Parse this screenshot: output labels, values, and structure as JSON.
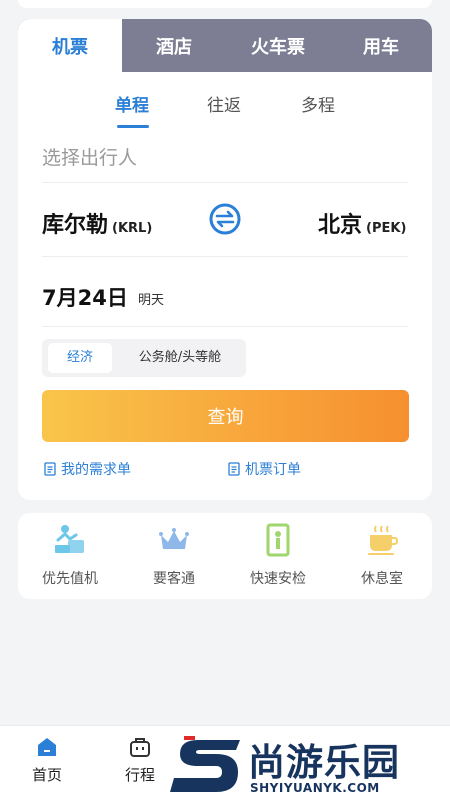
{
  "tabs": [
    {
      "label": "机票",
      "active": true
    },
    {
      "label": "酒店",
      "active": false
    },
    {
      "label": "火车票",
      "active": false
    },
    {
      "label": "用车",
      "active": false
    }
  ],
  "trip_types": [
    {
      "label": "单程",
      "active": true
    },
    {
      "label": "往返",
      "active": false
    },
    {
      "label": "多程",
      "active": false
    }
  ],
  "passenger_placeholder": "选择出行人",
  "route": {
    "from_city": "库尔勒",
    "from_code": "(KRL)",
    "to_city": "北京",
    "to_code": "(PEK)"
  },
  "date": {
    "value": "7月24日",
    "sub": "明天"
  },
  "cabin": {
    "options": [
      "经济",
      "公务舱/头等舱"
    ],
    "selected": "经济"
  },
  "search_label": "查询",
  "links": {
    "my_requests": "我的需求单",
    "flight_orders": "机票订单"
  },
  "services": [
    {
      "label": "优先值机",
      "icon": "priority-checkin-icon"
    },
    {
      "label": "要客通",
      "icon": "crown-icon"
    },
    {
      "label": "快速安检",
      "icon": "security-gate-icon"
    },
    {
      "label": "休息室",
      "icon": "coffee-cup-icon"
    }
  ],
  "bottom_nav": [
    {
      "label": "首页",
      "icon": "home-icon"
    },
    {
      "label": "行程",
      "icon": "luggage-icon"
    }
  ],
  "watermark": {
    "text": "尚游乐园",
    "sub": "SHYIYUANYK.COM"
  },
  "colors": {
    "accent": "#2b7fd6",
    "tab_bar": "#7d7e93",
    "button_start": "#f9c54a",
    "button_end": "#f6902f"
  }
}
